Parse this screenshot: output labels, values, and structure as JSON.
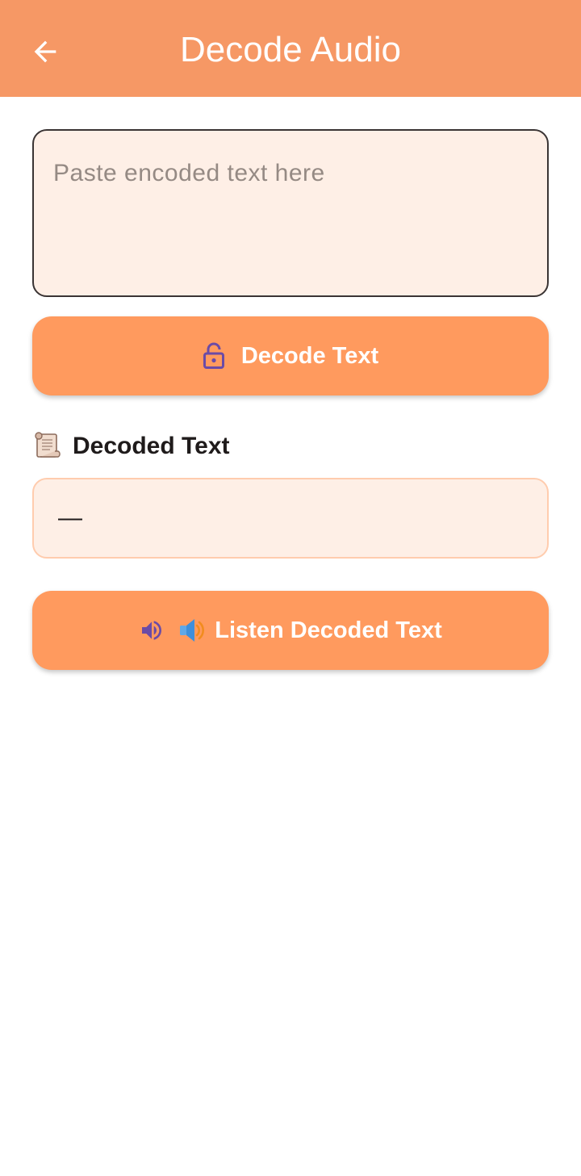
{
  "appbar": {
    "title": "Decode Audio",
    "back_icon": "arrow-left-icon",
    "color": "#F69865"
  },
  "input": {
    "placeholder": "Paste encoded text here",
    "value": ""
  },
  "decode_button": {
    "label": "Decode Text",
    "icon": "lock-open-icon"
  },
  "decoded_section": {
    "heading": "Decoded Text",
    "icon": "scroll-icon",
    "value": "—"
  },
  "listen_button": {
    "label": "Listen Decoded Text",
    "icons": [
      "volume-up-icon",
      "speaker-icon"
    ]
  },
  "colors": {
    "accent": "#FF9A5E",
    "field_background": "#FEEFE6",
    "icon_purple": "#6B4BA6"
  }
}
